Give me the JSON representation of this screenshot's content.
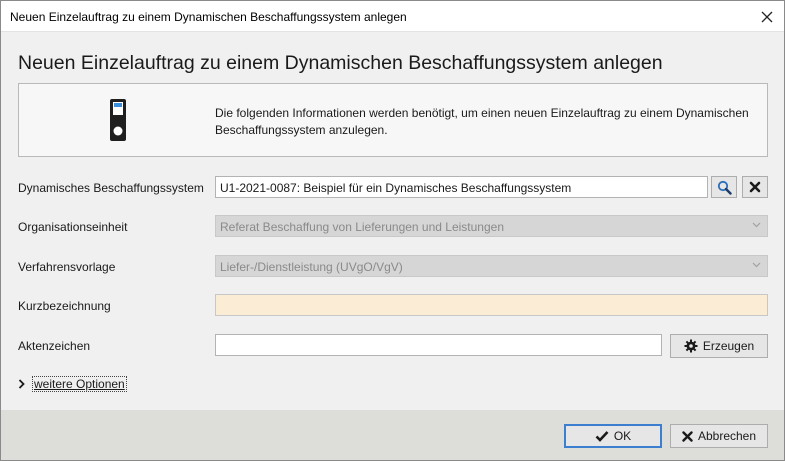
{
  "window": {
    "title": "Neuen Einzelauftrag zu einem Dynamischen Beschaffungssystem anlegen"
  },
  "page": {
    "heading": "Neuen Einzelauftrag zu einem Dynamischen Beschaffungssystem anlegen",
    "info_text": "Die folgenden Informationen werden benötigt, um einen neuen Einzelauftrag zu einem Dynamischen Beschaffungssystem anzulegen."
  },
  "form": {
    "dbs": {
      "label": "Dynamisches Beschaffungssystem",
      "value": "U1-2021-0087:  Beispiel für ein Dynamisches Beschaffungssystem"
    },
    "org": {
      "label": "Organisationseinheit",
      "value": "Referat Beschaffung von Lieferungen und Leistungen"
    },
    "template": {
      "label": "Verfahrensvorlage",
      "value": "Liefer-/Dienstleistung (UVgO/VgV)"
    },
    "short_name": {
      "label": "Kurzbezeichnung",
      "value": ""
    },
    "file_ref": {
      "label": "Aktenzeichen",
      "value": "",
      "generate_label": "Erzeugen"
    }
  },
  "more_options": {
    "label": "weitere Optionen"
  },
  "footer": {
    "ok_label": "OK",
    "cancel_label": "Abbrechen"
  },
  "colors": {
    "required_field_bg": "#fbecd5",
    "disabled_field_bg": "#d6d6d6",
    "primary_button_border": "#3c7fd0",
    "search_icon": "#2a6ebb"
  },
  "icons": {
    "device": "device-icon",
    "search": "search-icon",
    "clear": "clear-x-icon",
    "gear": "gear-icon",
    "check": "check-icon",
    "cancel": "x-icon",
    "expand": "chevron-right-icon"
  }
}
